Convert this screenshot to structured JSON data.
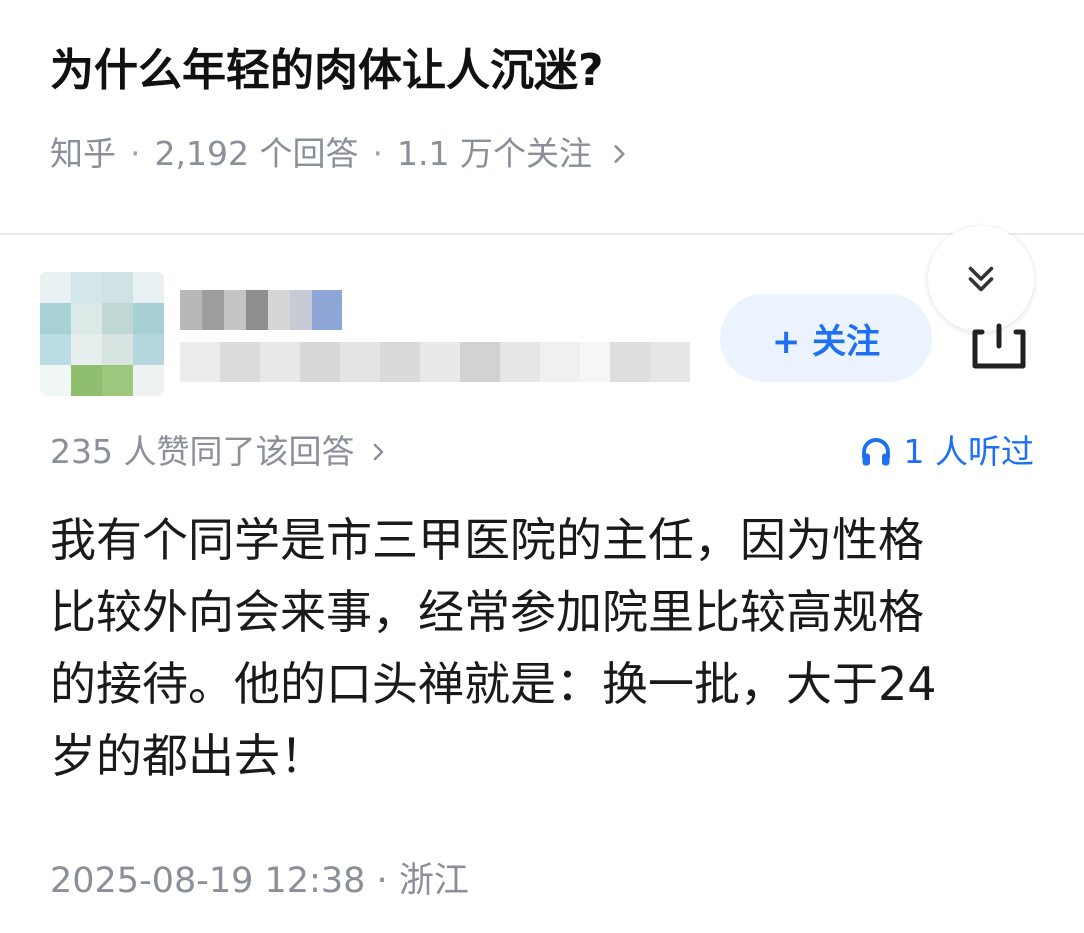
{
  "question": {
    "title": "为什么年轻的肉体让人沉迷?",
    "source": "知乎",
    "answer_count": "2,192 个回答",
    "follower_count": "1.1 万个关注"
  },
  "author": {
    "follow_label": "+ 关注"
  },
  "answer": {
    "upvote_text": "235 人赞同了该回答",
    "listened_text": "1 人听过",
    "content_lines": [
      "我有个同学是市三甲医院的主任，因为性格",
      "比较外向会来事，经常参加院里比较高规格",
      "的接待。他的口头禅就是：换一批，大于24",
      "岁的都出去！"
    ],
    "timestamp": "2025-08-19 12:38",
    "location": "浙江"
  },
  "colors": {
    "accent": "#1e6ff2",
    "follow_bg": "#ebf3ff",
    "meta_gray": "#8a8f99",
    "divider": "#ececec"
  },
  "icons": {
    "chevron": "chevron-right-icon",
    "collapse": "double-chevron-down-icon",
    "share": "share-icon",
    "headphones": "headphones-icon"
  }
}
